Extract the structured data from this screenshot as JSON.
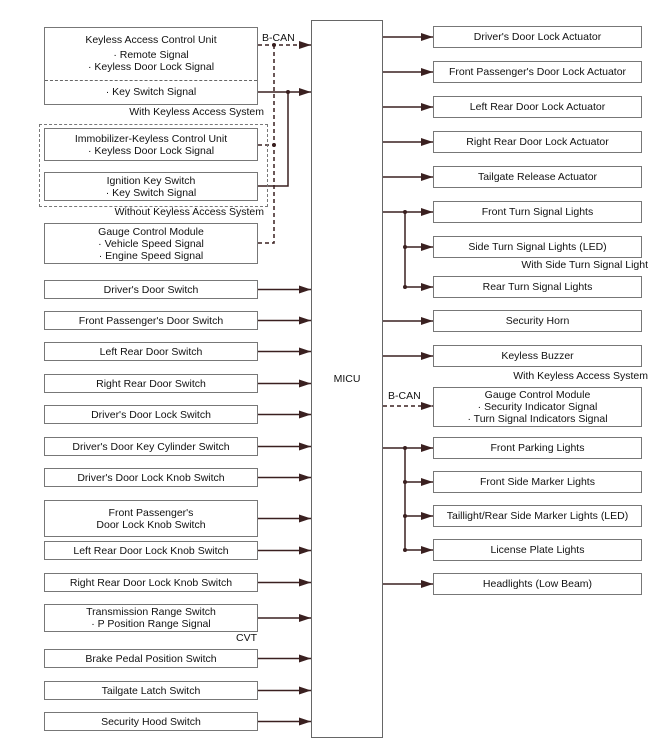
{
  "micu": {
    "label": "MICU"
  },
  "inputs_top": {
    "keyless_unit": {
      "title": "Keyless Access Control Unit",
      "signals": [
        "· Remote Signal",
        "· Keyless Door Lock Signal"
      ],
      "key_switch": "· Key Switch Signal"
    },
    "with_keyless": "With Keyless Access System",
    "immobilizer": {
      "title": "Immobilizer-Keyless Control Unit",
      "signals": [
        "· Keyless Door Lock Signal"
      ]
    },
    "ignition": {
      "title": "Ignition Key Switch",
      "signals": [
        "· Key Switch Signal"
      ]
    },
    "without_keyless": "Without Keyless Access System",
    "gauge": {
      "title": "Gauge Control Module",
      "signals": [
        "· Vehicle Speed Signal",
        "· Engine Speed Signal"
      ]
    },
    "bcan": "B-CAN"
  },
  "inputs": [
    "Driver's Door Switch",
    "Front Passenger's Door Switch",
    "Left Rear Door Switch",
    "Right Rear Door Switch",
    "Driver's Door Lock Switch",
    "Driver's Door Key Cylinder Switch",
    "Driver's Door Lock Knob Switch",
    "Front Passenger's\nDoor Lock Knob Switch",
    "Left Rear Door Lock Knob Switch",
    "Right Rear Door Lock Knob Switch",
    "Transmission Range Switch\n· P Position Range Signal",
    "Brake Pedal Position Switch",
    "Tailgate Latch Switch",
    "Security Hood Switch"
  ],
  "cvt_note": "CVT",
  "outputs": [
    "Driver's Door Lock Actuator",
    "Front Passenger's Door Lock Actuator",
    "Left Rear Door Lock Actuator",
    "Right Rear Door Lock Actuator",
    "Tailgate Release Actuator",
    "Front Turn Signal Lights",
    "Side Turn Signal Lights (LED)",
    "Rear Turn Signal Lights",
    "Security Horn",
    "Keyless Buzzer",
    "Gauge Control Module\n· Security Indicator Signal\n· Turn Signal Indicators Signal",
    "Front Parking Lights",
    "Front Side Marker Lights",
    "Taillight/Rear Side Marker Lights (LED)",
    "License Plate Lights",
    "Headlights (Low Beam)"
  ],
  "output_notes": {
    "side_turn": "With Side Turn Signal Light",
    "buzzer": "With Keyless Access System",
    "bcan": "B-CAN"
  }
}
